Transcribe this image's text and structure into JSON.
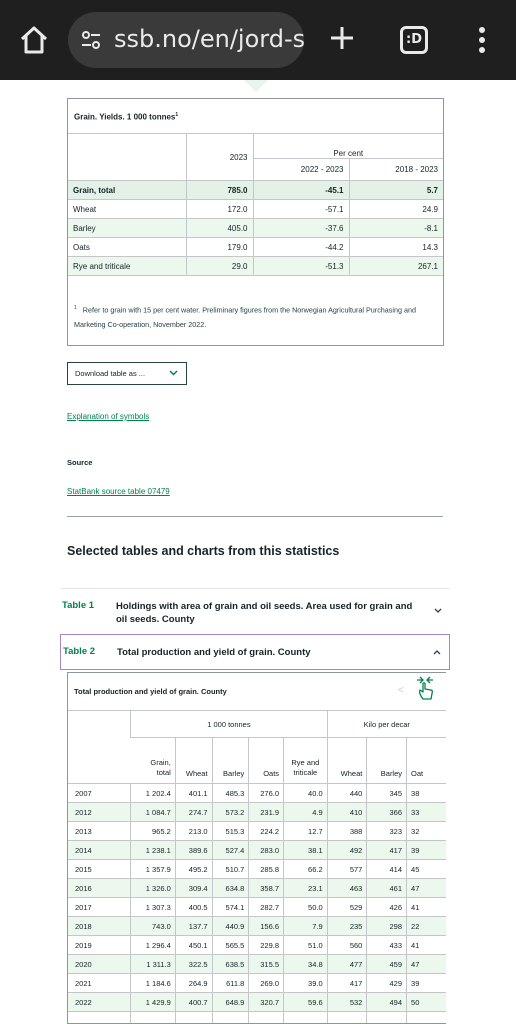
{
  "browser": {
    "url": "ssb.no/en/jord-sk",
    "tab_count": ":D"
  },
  "grain_table": {
    "caption": "Grain. Yields. 1 000 tonnes",
    "caption_sup": "1",
    "group_header": "Per cent",
    "col_year": "2023",
    "col_change1": "2022 - 2023",
    "col_change2": "2018 - 2023",
    "rows": [
      {
        "label": "Grain, total",
        "v2023": "785.0",
        "ch1": "-45.1",
        "ch2": "5.7"
      },
      {
        "label": "Wheat",
        "v2023": "172.0",
        "ch1": "-57.1",
        "ch2": "24.9"
      },
      {
        "label": "Barley",
        "v2023": "405.0",
        "ch1": "-37.6",
        "ch2": "-8.1"
      },
      {
        "label": "Oats",
        "v2023": "179.0",
        "ch1": "-44.2",
        "ch2": "14.3"
      },
      {
        "label": "Rye and triticale",
        "v2023": "29.0",
        "ch1": "-51.3",
        "ch2": "267.1"
      }
    ],
    "footnote_marker": "1",
    "footnote": "Refer to grain with 15 per cent water. Preliminary figures from the Norwegian Agricultural Purchasing and Marketing Co-operation, November 2022."
  },
  "download_button": "Download table as ...",
  "explanation_link": "Explanation of symbols",
  "source_label": "Source",
  "source_link": "StatBank source table 07479",
  "section_title": "Selected tables and charts from this statistics",
  "accordion": [
    {
      "num": "Table 1",
      "title": "Holdings with area of grain and oil seeds. Area used for grain and oil seeds. County"
    },
    {
      "num": "Table 2",
      "title": "Total production and yield of grain. County"
    }
  ],
  "prod_table": {
    "caption": "Total production and yield of grain. County",
    "scroll_left": "<",
    "group1": "1 000 tonnes",
    "group2": "Kilo per decar",
    "cols1": [
      "Grain, total",
      "Wheat",
      "Barley",
      "Oats",
      "Rye and triticale"
    ],
    "cols2": [
      "Wheat",
      "Barley",
      "Oat"
    ],
    "rows": [
      {
        "year": "2007",
        "v": [
          "1 202.4",
          "401.1",
          "485.3",
          "276.0",
          "40.0",
          "440",
          "345",
          "38"
        ]
      },
      {
        "year": "2012",
        "v": [
          "1 084.7",
          "274.7",
          "573.2",
          "231.9",
          "4.9",
          "410",
          "366",
          "33"
        ]
      },
      {
        "year": "2013",
        "v": [
          "965.2",
          "213.0",
          "515.3",
          "224.2",
          "12.7",
          "388",
          "323",
          "32"
        ]
      },
      {
        "year": "2014",
        "v": [
          "1 238.1",
          "389.6",
          "527.4",
          "283.0",
          "38.1",
          "492",
          "417",
          "39"
        ]
      },
      {
        "year": "2015",
        "v": [
          "1 357.9",
          "495.2",
          "510.7",
          "285.8",
          "66.2",
          "577",
          "414",
          "45"
        ]
      },
      {
        "year": "2016",
        "v": [
          "1 326.0",
          "309.4",
          "634.8",
          "358.7",
          "23.1",
          "463",
          "461",
          "47"
        ]
      },
      {
        "year": "2017",
        "v": [
          "1 307.3",
          "400.5",
          "574.1",
          "282.7",
          "50.0",
          "529",
          "426",
          "41"
        ]
      },
      {
        "year": "2018",
        "v": [
          "743.0",
          "137.7",
          "440.9",
          "156.6",
          "7.9",
          "235",
          "298",
          "22"
        ]
      },
      {
        "year": "2019",
        "v": [
          "1 296.4",
          "450.1",
          "565.5",
          "229.8",
          "51.0",
          "560",
          "433",
          "41"
        ]
      },
      {
        "year": "2020",
        "v": [
          "1 311.3",
          "322.5",
          "638.5",
          "315.5",
          "34.8",
          "477",
          "459",
          "47"
        ]
      },
      {
        "year": "2021",
        "v": [
          "1 184.6",
          "264.9",
          "611.8",
          "269.0",
          "39.0",
          "417",
          "429",
          "39"
        ]
      },
      {
        "year": "2022",
        "v": [
          "1 429.9",
          "400.7",
          "648.9",
          "320.7",
          "59.6",
          "532",
          "494",
          "50"
        ]
      }
    ]
  },
  "colors": {
    "brand_green": "#00824d",
    "row_highlight": "#ecf7ee",
    "focus_border": "#a784c7"
  }
}
